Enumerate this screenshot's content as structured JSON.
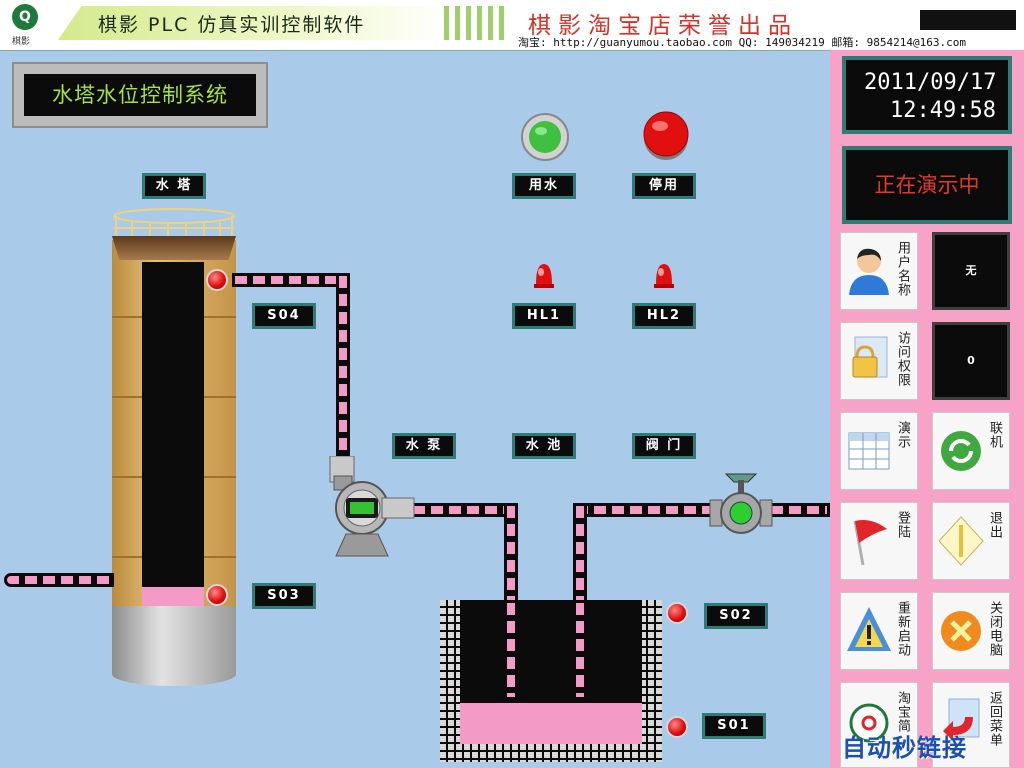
{
  "header": {
    "logo_text": "棋影",
    "app_title": "棋影 PLC 仿真实训控制软件",
    "shop_title": "棋影淘宝店荣誉出品",
    "contact": "淘宝: http://guanyumou.taobao.com  QQ: 149034219  邮箱: 9854214@163.com"
  },
  "system_title": "水塔水位控制系统",
  "clock": {
    "date": "2011/09/17",
    "time": "12:49:58"
  },
  "demo_status": "正在演示中",
  "labels": {
    "water_tower": "水 塔",
    "use_water": "用水",
    "stop": "停用",
    "s04": "S04",
    "s03": "S03",
    "s02": "S02",
    "s01": "S01",
    "hl1": "HL1",
    "hl2": "HL2",
    "pump": "水 泵",
    "pool": "水 池",
    "valve": "阀 门"
  },
  "right_panel": {
    "user_name_label": "用户名称",
    "user_name_value": "无",
    "access_label": "访问权限",
    "access_value": "0",
    "demo_label": "演示",
    "online_label": "联机",
    "login_label": "登陆",
    "exit_label": "退出",
    "restart_label": "重新启动",
    "shutdown_label": "关闭电脑",
    "taobao_label": "淘宝简",
    "back_menu_label": "返回菜单"
  },
  "watermark": "自动秒链接",
  "colors": {
    "background": "#a9cbe9",
    "panel": "#f6a3c7",
    "water": "#f49ac6",
    "led_green": "#3fc03f",
    "led_red": "#e01010",
    "title_text": "#a7e33a",
    "status_text": "#e23a2a"
  }
}
